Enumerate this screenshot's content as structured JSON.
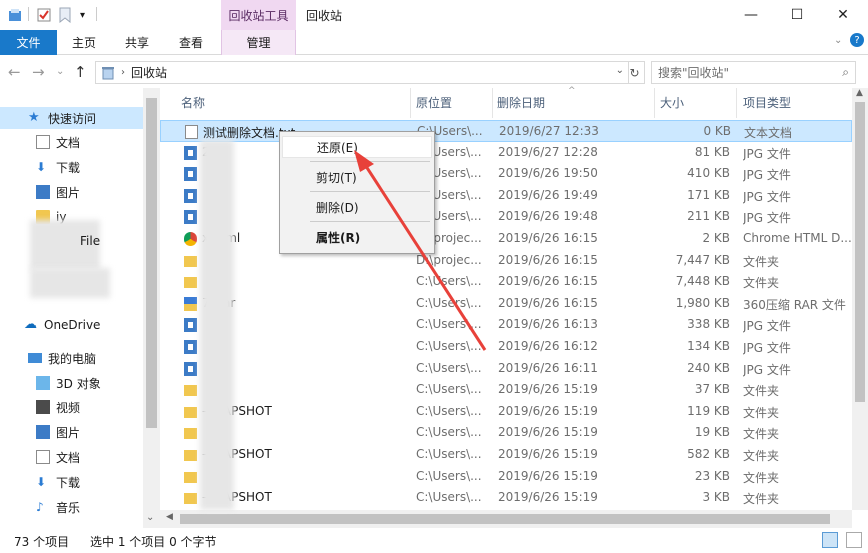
{
  "window": {
    "title": "回收站",
    "tool_tab_title": "回收站工具",
    "minimize": "—",
    "maximize": "☐",
    "close": "✕"
  },
  "ribbon": {
    "tabs": [
      "文件",
      "主页",
      "共享",
      "查看",
      "管理"
    ]
  },
  "address": {
    "crumb": "回收站",
    "search_placeholder": "搜索\"回收站\""
  },
  "nav": {
    "quick_access": "快速访问",
    "items": [
      "文档",
      "下载",
      "图片",
      "iy",
      "File",
      "OneDrive",
      "我的电脑",
      "3D 对象",
      "视频",
      "图片",
      "文档",
      "下载",
      "音乐"
    ]
  },
  "columns": [
    "名称",
    "原位置",
    "删除日期",
    "大小",
    "项目类型"
  ],
  "files": [
    {
      "name": "测试删除文档.txt",
      "loc": "C:\\Users\\...",
      "date": "2019/6/27 12:33",
      "size": "0 KB",
      "type": "文本文档",
      "icon": "text-file-icon"
    },
    {
      "name": "2",
      "loc": "C:\\Users\\...",
      "date": "2019/6/27 12:28",
      "size": "81 KB",
      "type": "JPG 文件",
      "icon": "image-file-icon"
    },
    {
      "name": "",
      "loc": "C:\\Users\\...",
      "date": "2019/6/26 19:50",
      "size": "410 KB",
      "type": "JPG 文件",
      "icon": "image-file-icon"
    },
    {
      "name": "",
      "loc": "C:\\Users\\...",
      "date": "2019/6/26 19:49",
      "size": "171 KB",
      "type": "JPG 文件",
      "icon": "image-file-icon"
    },
    {
      "name": "",
      "loc": "C:\\Users\\...",
      "date": "2019/6/26 19:48",
      "size": "211 KB",
      "type": "JPG 文件",
      "icon": "image-file-icon"
    },
    {
      "name": "x.html",
      "loc": "D:\\projec...",
      "date": "2019/6/26 16:15",
      "size": "2 KB",
      "type": "Chrome HTML D...",
      "icon": "chrome-icon"
    },
    {
      "name": "",
      "loc": "D:\\projec...",
      "date": "2019/6/26 16:15",
      "size": "7,447 KB",
      "type": "文件夹",
      "icon": "folder-icon"
    },
    {
      "name": "",
      "loc": "C:\\Users\\...",
      "date": "2019/6/26 16:15",
      "size": "7,448 KB",
      "type": "文件夹",
      "icon": "folder-icon"
    },
    {
      "name": "7).rar",
      "loc": "C:\\Users\\...",
      "date": "2019/6/26 16:15",
      "size": "1,980 KB",
      "type": "360压缩 RAR 文件",
      "icon": "rar-icon"
    },
    {
      "name": "",
      "loc": "C:\\Users\\...",
      "date": "2019/6/26 16:13",
      "size": "338 KB",
      "type": "JPG 文件",
      "icon": "image-file-icon"
    },
    {
      "name": "",
      "loc": "C:\\Users\\...",
      "date": "2019/6/26 16:12",
      "size": "134 KB",
      "type": "JPG 文件",
      "icon": "image-file-icon"
    },
    {
      "name": "",
      "loc": "C:\\Users\\...",
      "date": "2019/6/26 16:11",
      "size": "240 KB",
      "type": "JPG 文件",
      "icon": "image-file-icon"
    },
    {
      "name": "",
      "loc": "C:\\Users\\...",
      "date": "2019/6/26 15:19",
      "size": "37 KB",
      "type": "文件夹",
      "icon": "folder-icon"
    },
    {
      "name": "-SNAPSHOT",
      "loc": "C:\\Users\\...",
      "date": "2019/6/26 15:19",
      "size": "119 KB",
      "type": "文件夹",
      "icon": "folder-icon"
    },
    {
      "name": "",
      "loc": "C:\\Users\\...",
      "date": "2019/6/26 15:19",
      "size": "19 KB",
      "type": "文件夹",
      "icon": "folder-icon"
    },
    {
      "name": "-SNAPSHOT",
      "loc": "C:\\Users\\...",
      "date": "2019/6/26 15:19",
      "size": "582 KB",
      "type": "文件夹",
      "icon": "folder-icon"
    },
    {
      "name": "",
      "loc": "C:\\Users\\...",
      "date": "2019/6/26 15:19",
      "size": "23 KB",
      "type": "文件夹",
      "icon": "folder-icon"
    },
    {
      "name": "-SNAPSHOT",
      "loc": "C:\\Users\\...",
      "date": "2019/6/26 15:19",
      "size": "3 KB",
      "type": "文件夹",
      "icon": "folder-icon"
    }
  ],
  "context_menu": {
    "restore": "还原(E)",
    "cut": "剪切(T)",
    "delete": "删除(D)",
    "properties": "属性(R)"
  },
  "status": {
    "count": "73 个项目",
    "selected": "选中 1 个项目  0 个字节"
  },
  "colors": {
    "accent": "#1979ca",
    "selection": "#cce8ff",
    "tool_tab": "#f0d8f1",
    "arrow": "#e8413a"
  }
}
